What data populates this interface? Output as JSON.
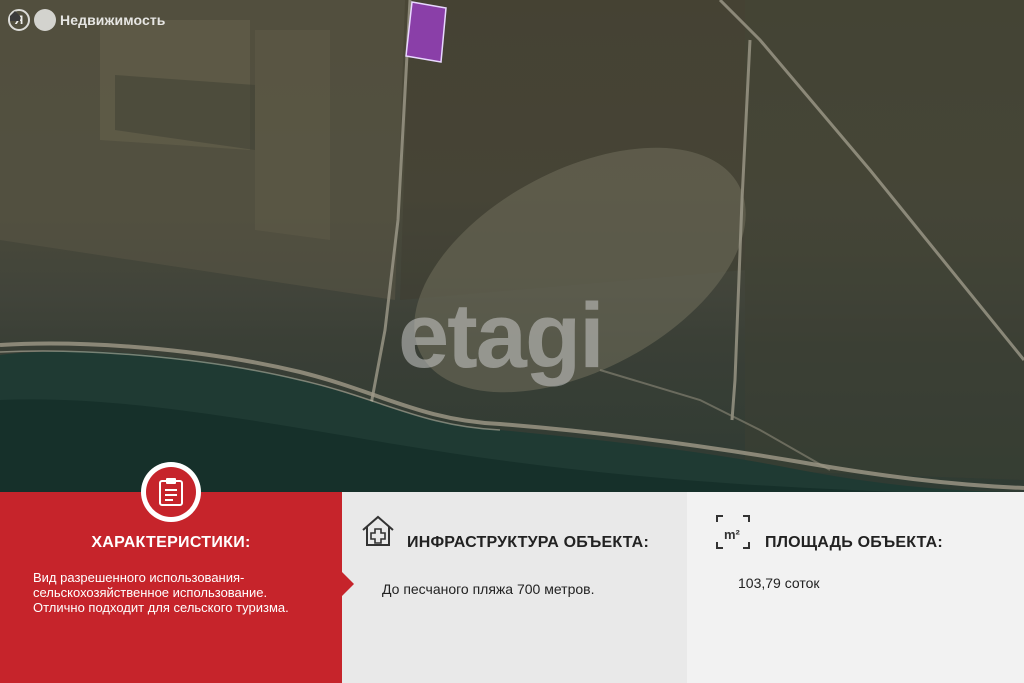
{
  "brand": {
    "logo_letter": "Я",
    "name": "Недвижимость"
  },
  "watermark": "etagi",
  "characteristics": {
    "title": "ХАРАКТЕРИСТИКИ:",
    "lines": [
      "Вид разрешенного использования-",
      "сельскохозяйственное использование.",
      "Отлично подходит для сельского туризма."
    ],
    "icon": "clipboard-icon"
  },
  "infrastructure": {
    "title": "ИНФРАСТРУКТУРА ОБЪЕКТА:",
    "text": "До песчаного пляжа 700 метров.",
    "icon": "house-medical-icon"
  },
  "area": {
    "title": "ПЛОЩАДЬ ОБЪЕКТА:",
    "icon_label": "m²",
    "value": "103,79 соток"
  },
  "colors": {
    "accent_red": "#c6242b",
    "plot_highlight": "#8a3fa8",
    "panel_grey": "#e9e9e9"
  }
}
